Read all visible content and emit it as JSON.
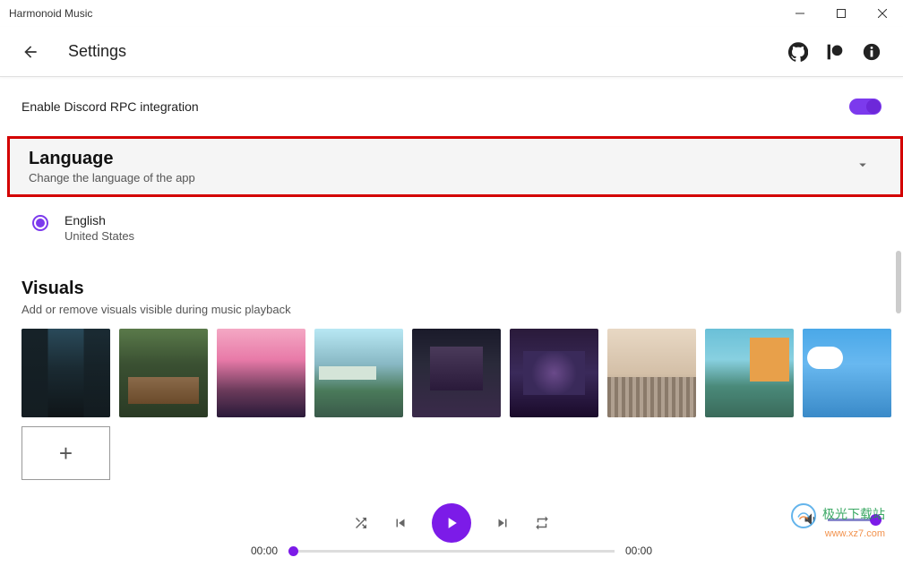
{
  "titlebar": {
    "title": "Harmonoid Music"
  },
  "header": {
    "title": "Settings"
  },
  "settings": {
    "discord_rpc": "Enable Discord RPC integration"
  },
  "language": {
    "title": "Language",
    "subtitle": "Change the language of the app",
    "selected": {
      "name": "English",
      "region": "United States"
    }
  },
  "visuals": {
    "title": "Visuals",
    "subtitle": "Add or remove visuals visible during music playback",
    "add_label": "+"
  },
  "player": {
    "time_current": "00:00",
    "time_total": "00:00"
  },
  "watermark": {
    "line1": "极光下载站",
    "line2": "www.xz7.com"
  }
}
